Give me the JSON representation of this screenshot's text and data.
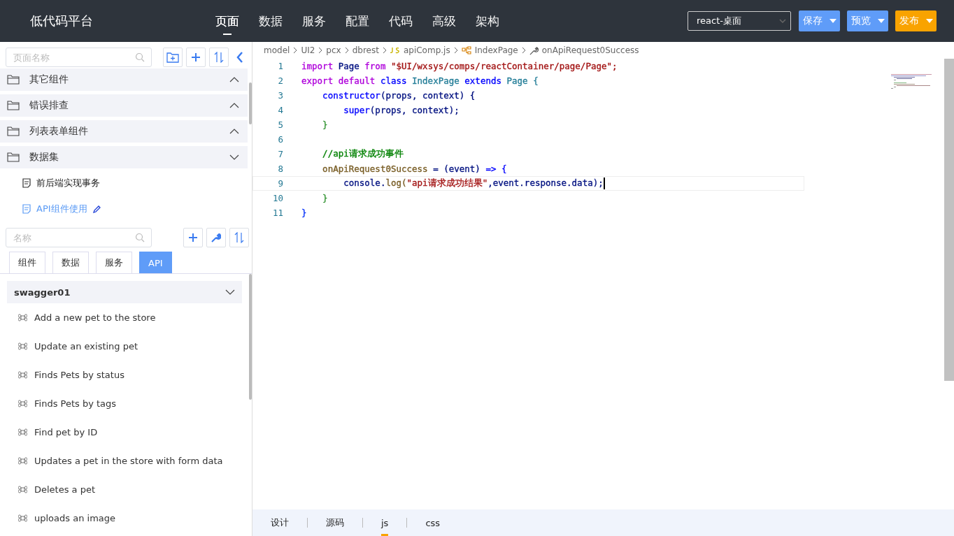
{
  "app": {
    "title": "低代码平台"
  },
  "nav": [
    {
      "label": "页面",
      "selected": true
    },
    {
      "label": "数据",
      "selected": false
    },
    {
      "label": "服务",
      "selected": false
    },
    {
      "label": "配置",
      "selected": false
    },
    {
      "label": "代码",
      "selected": false
    },
    {
      "label": "高级",
      "selected": false
    },
    {
      "label": "架构",
      "selected": false
    }
  ],
  "platform_select": {
    "value": "react-桌面"
  },
  "actions": [
    {
      "label": "保存",
      "kind": "primary"
    },
    {
      "label": "预览",
      "kind": "primary"
    },
    {
      "label": "发布",
      "kind": "warning"
    }
  ],
  "page_search": {
    "placeholder": "页面名称"
  },
  "page_tree": [
    {
      "label": "其它组件",
      "expanded": false
    },
    {
      "label": "错误排查",
      "expanded": false
    },
    {
      "label": "列表表单组件",
      "expanded": false
    },
    {
      "label": "数据集",
      "expanded": true,
      "children": [
        {
          "label": "前后端实现事务",
          "selected": false
        },
        {
          "label": "API组件使用",
          "selected": true
        }
      ]
    }
  ],
  "component_search": {
    "placeholder": "名称"
  },
  "panel_tabs": [
    {
      "label": "组件",
      "selected": false
    },
    {
      "label": "数据",
      "selected": false
    },
    {
      "label": "服务",
      "selected": false
    },
    {
      "label": "API",
      "selected": true
    }
  ],
  "api_groups": [
    {
      "label": "swagger01",
      "expanded": true,
      "items": [
        "Add a new pet to the store",
        "Update an existing pet",
        "Finds Pets by status",
        "Finds Pets by tags",
        "Find pet by ID",
        "Updates a pet in the store with form data",
        "Deletes a pet",
        "uploads an image"
      ]
    }
  ],
  "breadcrumb": [
    {
      "label": "model",
      "kind": "folder"
    },
    {
      "label": "UI2",
      "kind": "folder"
    },
    {
      "label": "pcx",
      "kind": "folder"
    },
    {
      "label": "dbrest",
      "kind": "folder"
    },
    {
      "label": "apiComp.js",
      "kind": "js"
    },
    {
      "label": "IndexPage",
      "kind": "class"
    },
    {
      "label": "onApiRequest0Success",
      "kind": "method"
    }
  ],
  "code_lines": [
    {
      "number": "1",
      "current": false,
      "tokens": [
        {
          "t": "import",
          "color": "#af00db"
        },
        {
          "t": " Page ",
          "color": "#001080"
        },
        {
          "t": "from",
          "color": "#af00db"
        },
        {
          "t": " \"$UI/wxsys/comps/reactContainer/page/Page\";",
          "color": "#a31515"
        }
      ]
    },
    {
      "number": "2",
      "current": false,
      "tokens": [
        {
          "t": "export default",
          "color": "#af00db"
        },
        {
          "t": " class",
          "color": "#0000ff"
        },
        {
          "t": " IndexPage ",
          "color": "#267f99"
        },
        {
          "t": "extends",
          "color": "#0000ff"
        },
        {
          "t": " Page {",
          "color": "#267f99"
        }
      ]
    },
    {
      "number": "3",
      "current": false,
      "tokens": [
        {
          "t": "    constructor",
          "color": "#0000ff"
        },
        {
          "t": "(props, context) {",
          "color": "#001080"
        }
      ]
    },
    {
      "number": "4",
      "current": false,
      "tokens": [
        {
          "t": "        super",
          "color": "#0000ff"
        },
        {
          "t": "(props, context);",
          "color": "#001080"
        }
      ]
    },
    {
      "number": "5",
      "current": false,
      "tokens": [
        {
          "t": "    }",
          "color": "#319331"
        }
      ]
    },
    {
      "number": "6",
      "current": false
    },
    {
      "number": "7",
      "current": false,
      "tokens": [
        {
          "t": "    //api请求成功事件",
          "color": "#008000"
        }
      ]
    },
    {
      "number": "8",
      "current": false,
      "tokens": [
        {
          "t": "    onApiRequest0Success",
          "color": "#795e26"
        },
        {
          "t": " = (event)",
          "color": "#001080"
        },
        {
          "t": " => {",
          "color": "#0000ff"
        }
      ]
    },
    {
      "number": "9",
      "current": true,
      "tokens": [
        {
          "t": "        console.",
          "color": "#001080"
        },
        {
          "t": "log(",
          "color": "#795e26"
        },
        {
          "t": "\"api请求成功结果\"",
          "color": "#a31515"
        },
        {
          "t": ",event.response.data);",
          "color": "#001080"
        }
      ]
    },
    {
      "number": "10",
      "current": false,
      "tokens": [
        {
          "t": "    }",
          "color": "#319331"
        }
      ]
    },
    {
      "number": "11",
      "current": false,
      "tokens": [
        {
          "t": "}",
          "color": "#0431fa"
        }
      ]
    }
  ],
  "editor_tabs": [
    {
      "label": "设计",
      "selected": false
    },
    {
      "label": "源码",
      "selected": false
    },
    {
      "label": "js",
      "selected": true
    },
    {
      "label": "css",
      "selected": false
    }
  ]
}
